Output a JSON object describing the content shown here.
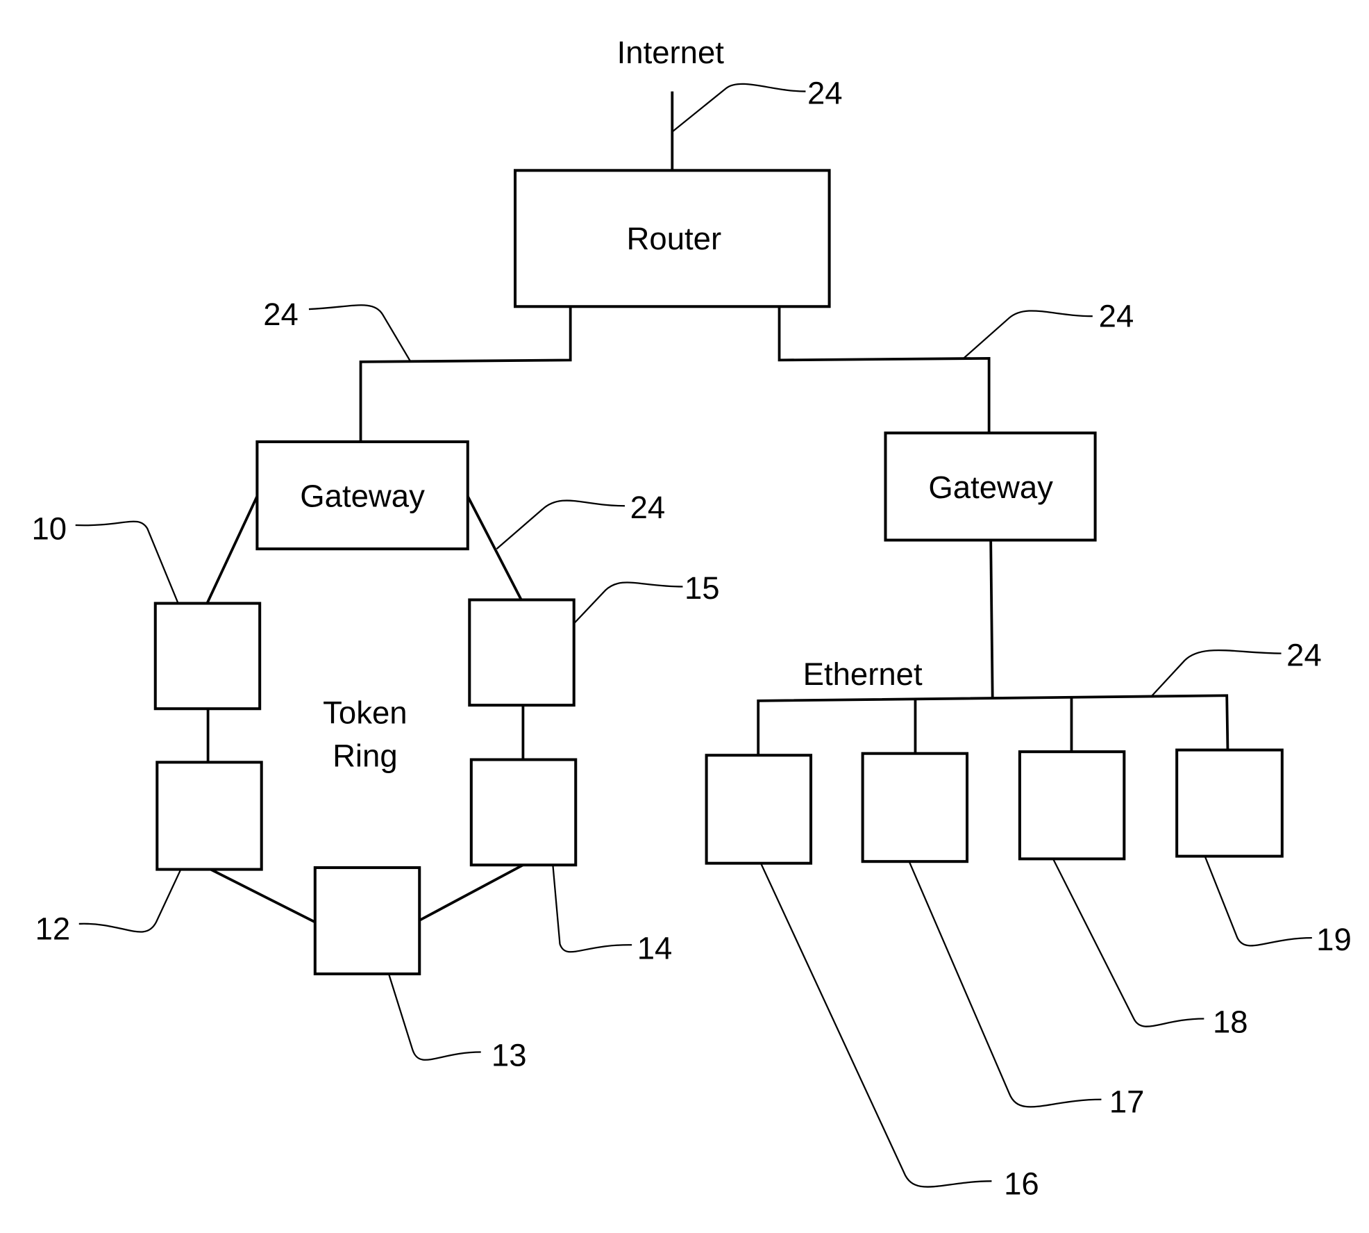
{
  "diagram": {
    "nodes": {
      "internet": "Internet",
      "router": "Router",
      "gateway_left": "Gateway",
      "gateway_right": "Gateway",
      "token_ring_line1": "Token",
      "token_ring_line2": "Ring",
      "ethernet": "Ethernet"
    },
    "refs": {
      "internet_link": "24",
      "router_left_link": "24",
      "router_right_link": "24",
      "ring_link": "24",
      "ethernet_bus": "24",
      "node_10": "10",
      "node_12": "12",
      "node_13": "13",
      "node_14": "14",
      "node_15": "15",
      "node_16": "16",
      "node_17": "17",
      "node_18": "18",
      "node_19": "19"
    }
  }
}
